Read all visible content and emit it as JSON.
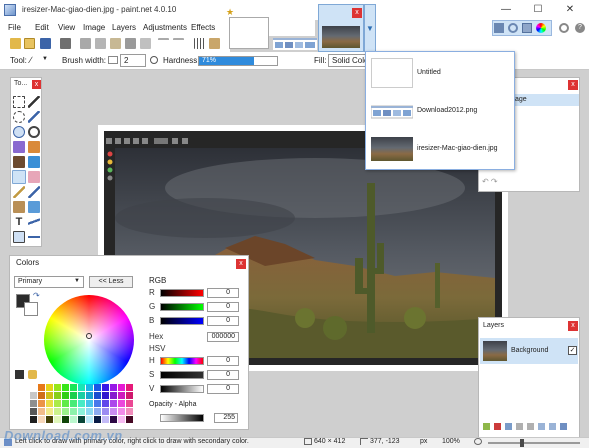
{
  "window": {
    "title": "iresizer-Mac-giao-dien.jpg - paint.net 4.0.10",
    "minimize": "—",
    "maximize": "☐",
    "close": "✕"
  },
  "menu": [
    "File",
    "Edit",
    "View",
    "Image",
    "Layers",
    "Adjustments",
    "Effects"
  ],
  "toolbar": {
    "tool_label": "Tool:",
    "brush_width_label": "Brush width:",
    "brush_width_value": "2",
    "hardness_label": "Hardness:",
    "hardness_value": "71%",
    "hardness_fraction": 0.71,
    "fill_label": "Fill:",
    "fill_value": "Solid Color"
  },
  "image_tabs": {
    "selected_close": "x",
    "dropdown_arrow": "▼",
    "star": "★"
  },
  "image_list": [
    {
      "label": "Untitled"
    },
    {
      "label": "Download2012.png"
    },
    {
      "label": "iresizer-Mac-giao-dien.jpg"
    }
  ],
  "tools_panel": {
    "title": "To...",
    "close": "x"
  },
  "history_panel": {
    "close": "x",
    "item_label": "age"
  },
  "colors_panel": {
    "title": "Colors",
    "close": "x",
    "mode": "Primary",
    "less_button": "<< Less",
    "rgb_heading": "RGB",
    "channels": [
      {
        "label": "R",
        "value": "0"
      },
      {
        "label": "G",
        "value": "0"
      },
      {
        "label": "B",
        "value": "0"
      }
    ],
    "hex_label": "Hex",
    "hex_value": "000000",
    "hsv_heading": "HSV",
    "hsv_channels": [
      {
        "label": "H",
        "value": "0"
      },
      {
        "label": "S",
        "value": "0"
      },
      {
        "label": "V",
        "value": "0"
      }
    ],
    "opacity_label": "Opacity - Alpha",
    "opacity_value": "255"
  },
  "layers_panel": {
    "title": "Layers",
    "close": "x",
    "layer_name": "Background",
    "visible_check": "✓"
  },
  "status": {
    "hint": "Left click to draw with primary color, right click to draw with secondary color.",
    "image_size": "640 × 412",
    "cursor_pos": "377, -123",
    "units": "px",
    "zoom": "100%"
  },
  "watermark": "Download.com.vn",
  "colors": {
    "accent": "#2f8bdc",
    "close_red": "#d33333",
    "selection_blue": "#cfe3f6"
  }
}
